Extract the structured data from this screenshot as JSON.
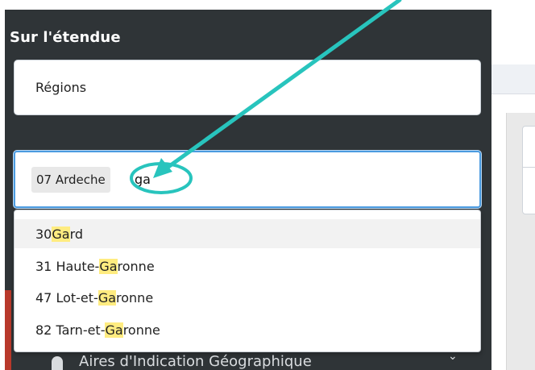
{
  "sidebar": {
    "title": "Sur l'étendue",
    "scope_select": {
      "value": "Régions"
    },
    "search": {
      "chip": "07 Ardeche",
      "typed": "ga"
    },
    "options": [
      {
        "pre": "30 ",
        "match": "Ga",
        "post": "rd"
      },
      {
        "pre": "31 Haute-",
        "match": "Ga",
        "post": "ronne"
      },
      {
        "pre": "47 Lot-et-",
        "match": "Ga",
        "post": "ronne"
      },
      {
        "pre": "82 Tarn-et-",
        "match": "Ga",
        "post": "ronne"
      }
    ],
    "bottom_item": {
      "label": "Aires d'Indication Géographique"
    }
  },
  "colors": {
    "sidebar_bg": "#2f3437",
    "focus_border": "#4b9be0",
    "highlight": "#ffec80",
    "annotation": "#28c4bd"
  },
  "icons": [
    "pin-icon",
    "chevron-down-icon",
    "annotation-arrow",
    "annotation-circle"
  ]
}
